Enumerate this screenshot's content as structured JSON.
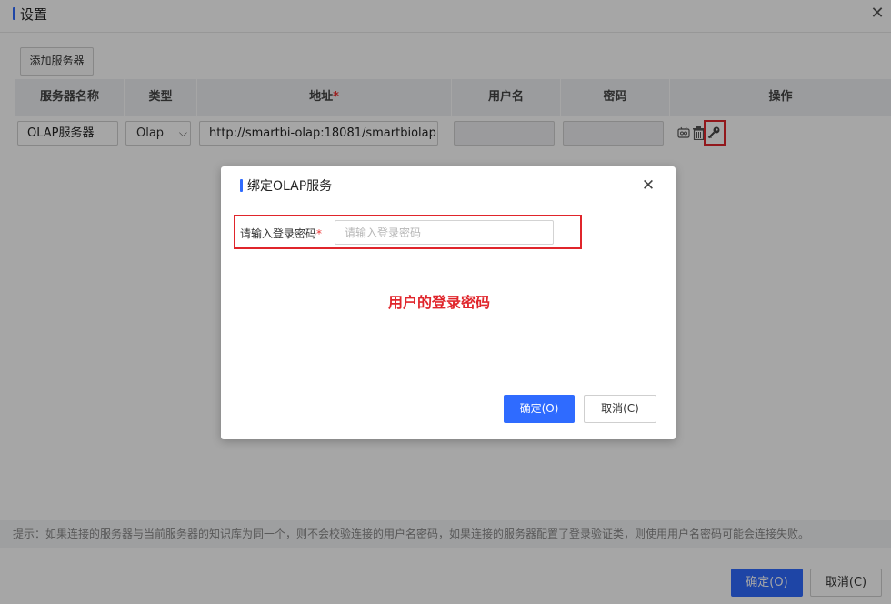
{
  "window": {
    "title": "设置",
    "close_icon": "close-icon"
  },
  "toolbar": {
    "add_server_label": "添加服务器"
  },
  "table": {
    "columns": [
      "服务器名称",
      "类型",
      "地址",
      "用户名",
      "密码",
      "操作"
    ],
    "address_required_mark": "*",
    "rows": [
      {
        "server_name": "OLAP服务器",
        "type": "Olap",
        "address": "http://smartbi-olap:18081/smartbiolap",
        "username": "",
        "password": "",
        "ops": [
          "test-connection-icon",
          "delete-icon",
          "key-icon"
        ]
      }
    ]
  },
  "hint": {
    "text": "提示：如果连接的服务器与当前服务器的知识库为同一个，则不会校验连接的用户名密码，如果连接的服务器配置了登录验证类，则使用用户名密码可能会连接失败。"
  },
  "footer": {
    "ok_label": "确定(O)",
    "cancel_label": "取消(C)"
  },
  "modal": {
    "title": "绑定OLAP服务",
    "password_label": "请输入登录密码",
    "required_mark": "*",
    "password_placeholder": "请输入登录密码",
    "password_value": "",
    "annotation": "用户的登录密码",
    "ok_label": "确定(O)",
    "cancel_label": "取消(C)"
  },
  "colors": {
    "accent": "#2f6bff",
    "highlight": "#e0252b"
  }
}
